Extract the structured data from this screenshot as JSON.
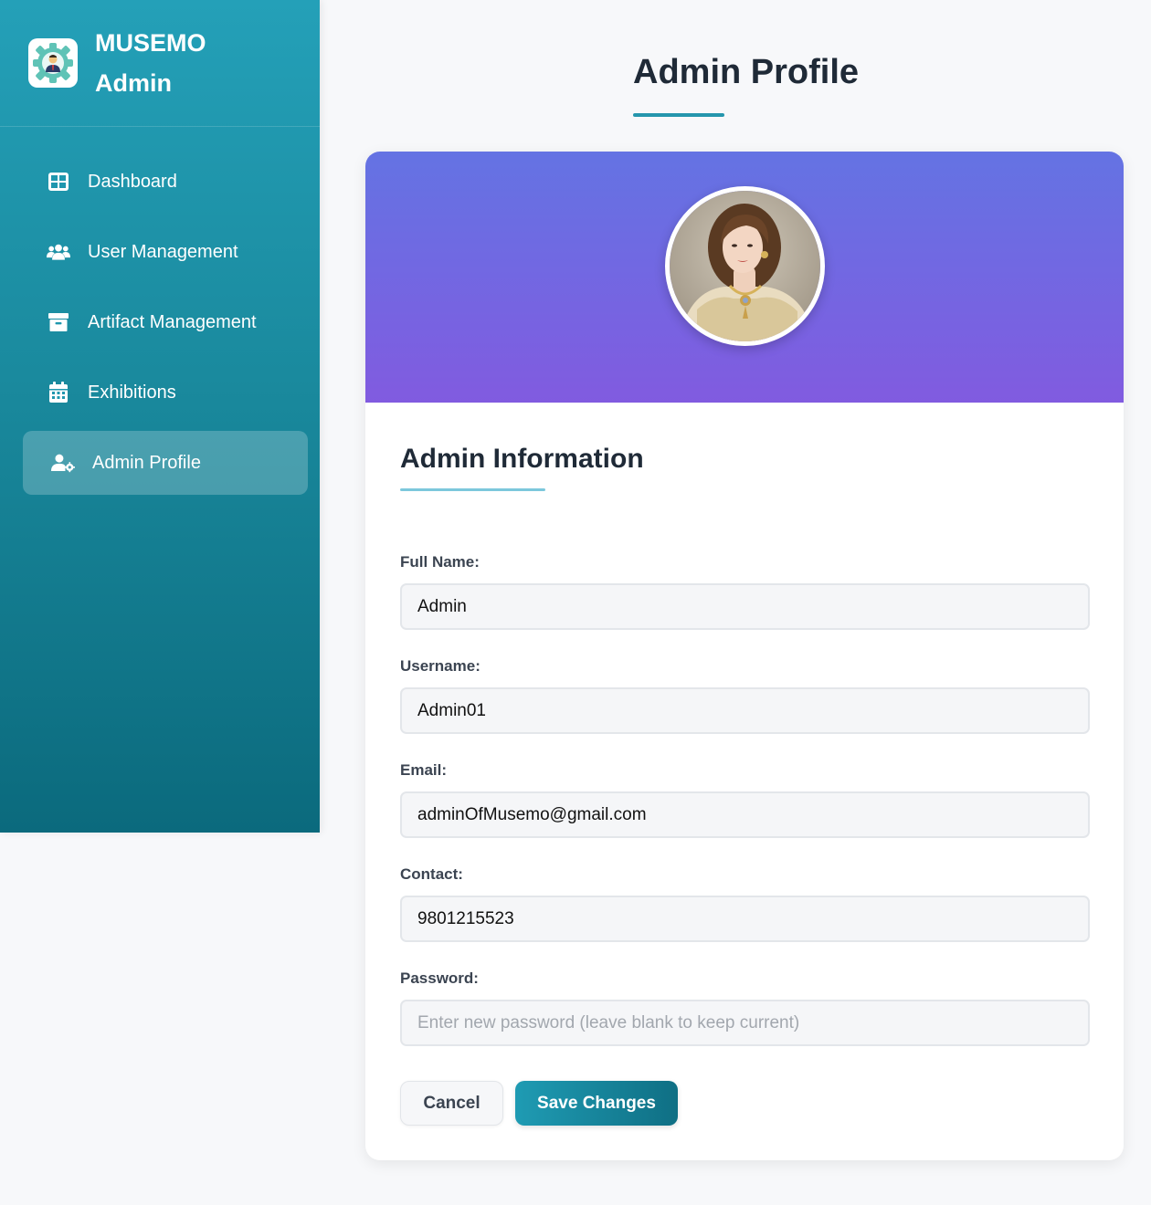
{
  "brand": {
    "line1": "MUSEMO",
    "line2": "Admin",
    "logo_icon": "admin-gear-icon"
  },
  "sidebar": {
    "items": [
      {
        "label": "Dashboard",
        "icon": "dashboard-grid-icon",
        "active": false
      },
      {
        "label": "User Management",
        "icon": "users-icon",
        "active": false
      },
      {
        "label": "Artifact Management",
        "icon": "archive-box-icon",
        "active": false
      },
      {
        "label": "Exhibitions",
        "icon": "calendar-icon",
        "active": false
      },
      {
        "label": "Admin Profile",
        "icon": "user-cog-icon",
        "active": true
      }
    ]
  },
  "header": {
    "title": "Admin Profile"
  },
  "profile": {
    "section_title": "Admin Information",
    "fields": [
      {
        "label": "Full Name:",
        "value": "Admin",
        "placeholder": ""
      },
      {
        "label": "Username:",
        "value": "Admin01",
        "placeholder": ""
      },
      {
        "label": "Email:",
        "value": "adminOfMusemo@gmail.com",
        "placeholder": ""
      },
      {
        "label": "Contact:",
        "value": "9801215523",
        "placeholder": ""
      },
      {
        "label": "Password:",
        "value": "",
        "placeholder": "Enter new password (leave blank to keep current)"
      }
    ],
    "cancel_label": "Cancel",
    "save_label": "Save Changes"
  },
  "colors": {
    "accent": "#2596ad",
    "banner_top": "#6473e3",
    "banner_bottom": "#815be0"
  }
}
